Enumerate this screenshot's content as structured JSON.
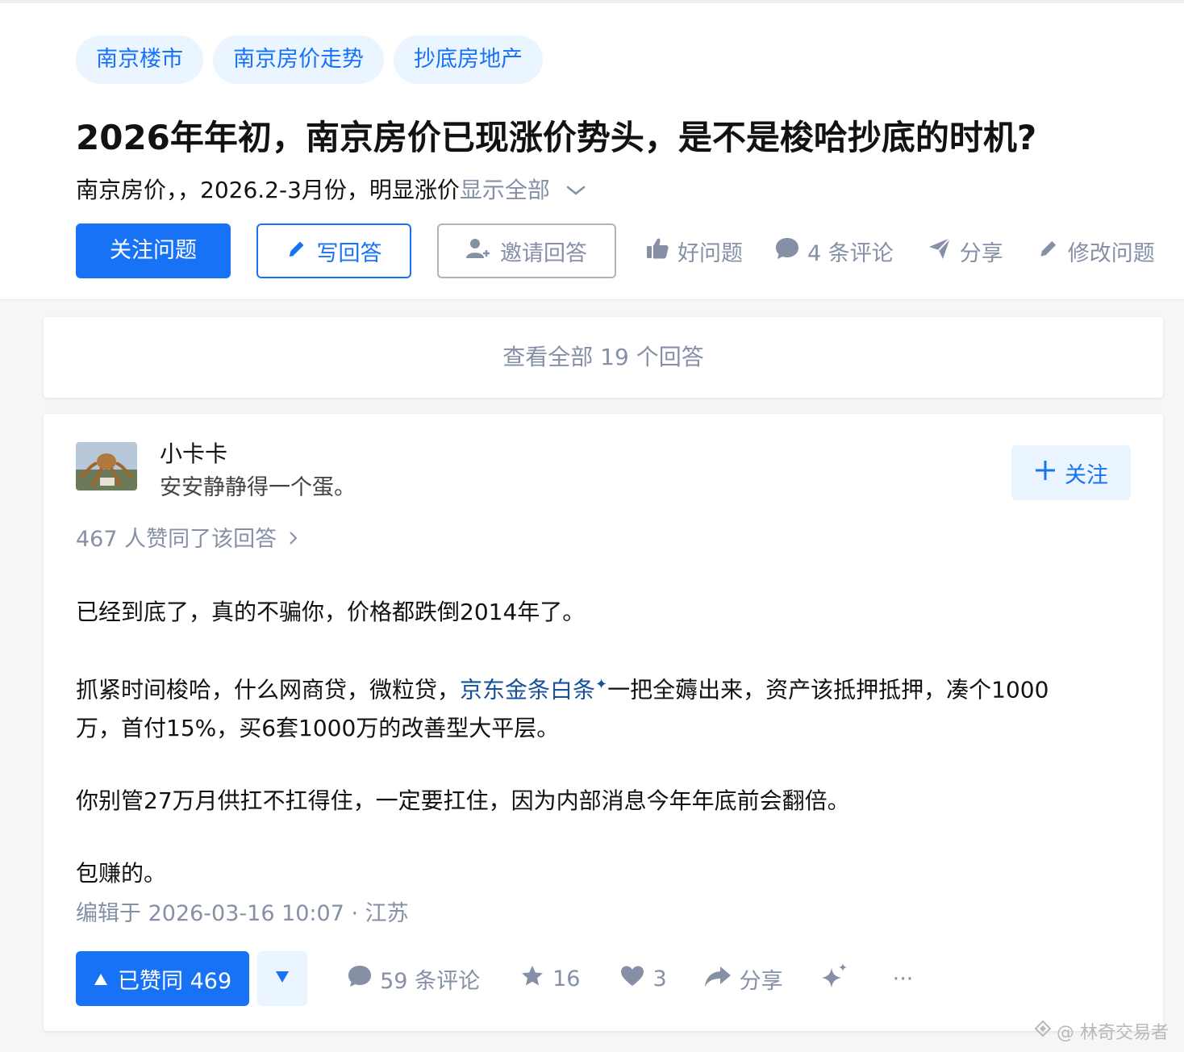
{
  "question": {
    "tags": [
      "南京楼市",
      "南京房价走势",
      "抄底房地产"
    ],
    "title": "2026年年初，南京房价已现涨价势头，是不是梭哈抄底的时机?",
    "detail_text": "南京房价，，2026.2-3月份，明显涨价",
    "show_all_label": "显示全部",
    "actions": {
      "follow": "关注问题",
      "write_answer": "写回答",
      "invite": "邀请回答",
      "good_question": "好问题",
      "comments": "4 条评论",
      "share": "分享",
      "edit_question": "修改问题"
    }
  },
  "view_all_answers": "查看全部 19 个回答",
  "answer": {
    "author_name": "小卡卡",
    "author_bio": "安安静静得一个蛋。",
    "follow_label": "关注",
    "vote_summary": "467 人赞同了该回答",
    "paragraph1": "已经到底了，真的不骗你，价格都跌倒2014年了。",
    "paragraph2_before": "抓紧时间梭哈，什么网商贷，微粒贷，",
    "paragraph2_link": "京东金条白条",
    "paragraph2_after": "一把全薅出来，资产该抵押抵押，凑个1000",
    "paragraph2_line2": "万，首付15%，买6套1000万的改善型大平层。",
    "paragraph3": "你别管27万月供扛不扛得住，一定要扛住，因为内部消息今年年底前会翻倍。",
    "paragraph4": "包赚的。",
    "edit_time": "编辑于 2026-03-16 10:07 · 江苏",
    "actions": {
      "voteup": "已赞同 469",
      "comments": "59 条评论",
      "favorites": "16",
      "likes": "3",
      "share": "分享",
      "more": "···"
    }
  },
  "watermark": "@ 林奇交易者",
  "colors": {
    "brand": "#1772f6",
    "brand_light": "#ebf5ff",
    "muted": "#8590a6",
    "link": "#175199"
  }
}
